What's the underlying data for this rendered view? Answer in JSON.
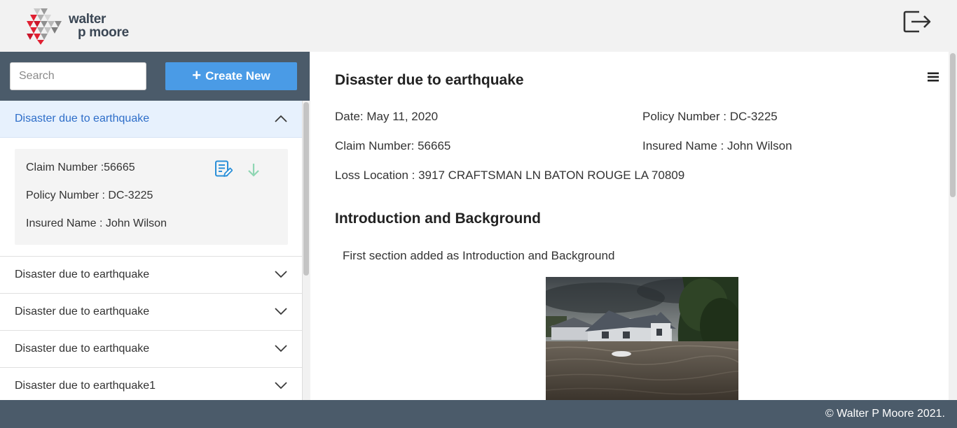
{
  "header": {
    "logo": {
      "line1": "walter",
      "line2": "p moore",
      "icon": "walter-p-moore-logo"
    },
    "logout_icon": "logout-icon"
  },
  "sidebar": {
    "search": {
      "placeholder": "Search",
      "value": ""
    },
    "create_button": {
      "icon": "plus-icon",
      "label": "Create New"
    },
    "items": [
      {
        "title": "Disaster due to earthquake",
        "expanded": true,
        "details": {
          "claim": "Claim Number :56665",
          "policy": "Policy Number : DC-3225",
          "insured": "Insured Name : John Wilson"
        },
        "icons": [
          "edit-document-icon",
          "download-arrow-icon"
        ]
      },
      {
        "title": "Disaster due to earthquake",
        "expanded": false
      },
      {
        "title": "Disaster due to earthquake",
        "expanded": false
      },
      {
        "title": "Disaster due to earthquake",
        "expanded": false
      },
      {
        "title": "Disaster due to earthquake1",
        "expanded": false
      }
    ]
  },
  "main": {
    "title": "Disaster due to earthquake",
    "menu_icon": "hamburger-menu-icon",
    "date": "Date: May 11, 2020",
    "policy": "Policy Number : DC-3225",
    "claim": "Claim Number: 56665",
    "insured": "Insured Name : John Wilson",
    "location": "Loss Location : 3917 CRAFTSMAN LN BATON ROUGE LA 70809",
    "section_title": "Introduction and Background",
    "section_text": "First section added as Introduction and Background",
    "image": "flooded-house-photo"
  },
  "footer": {
    "text": "© Walter P Moore 2021."
  },
  "colors": {
    "header_bg": "#f2f2f2",
    "sidebar_top_bg": "#4b5b6a",
    "accent": "#4a9be6",
    "active_item_bg": "#e7f1fd",
    "active_item_text": "#2e6ec9",
    "footer_bg": "#4b5b6a"
  }
}
